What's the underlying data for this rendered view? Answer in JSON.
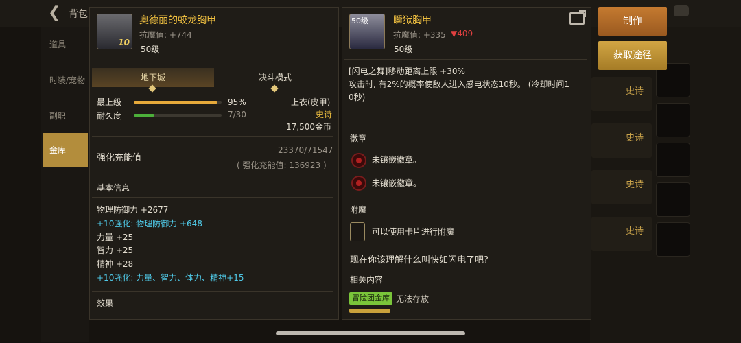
{
  "background": {
    "back_label": "背包",
    "sidebar": [
      "道具",
      "时装/宠物",
      "副职",
      "金库"
    ],
    "rows": [
      "史诗",
      "史诗",
      "史诗",
      "史诗",
      "史诗"
    ]
  },
  "item1": {
    "name": "奥德丽的蛟龙胸甲",
    "resist": "抗魔值: +744",
    "level": "50级",
    "icon_badge": "10",
    "tabs": [
      "地下城",
      "决斗模式"
    ],
    "top_grade_label": "最上级",
    "top_grade_value": "95%",
    "top_grade_fill": 0.95,
    "durability_label": "耐久度",
    "durability_value": "7/30",
    "durability_fill": 0.2333,
    "type": "上衣(皮甲)",
    "rarity": "史诗",
    "price": "17,500金币",
    "charge_label": "强化充能值",
    "charge_value": "23370/71547",
    "charge_sub": "( 强化充能值: 136923 )",
    "basic_title": "基本信息",
    "stats": [
      {
        "text": "物理防御力 +2677",
        "color": "#e2dccf"
      },
      {
        "text": "+10强化: 物理防御力 +648",
        "color": "#4fc8e6"
      },
      {
        "text": "力量 +25",
        "color": "#e2dccf"
      },
      {
        "text": "智力 +25",
        "color": "#e2dccf"
      },
      {
        "text": "精神 +28",
        "color": "#e2dccf"
      },
      {
        "text": "+10强化: 力量、智力、体力、精神+15",
        "color": "#4fc8e6"
      }
    ],
    "effect_title": "效果"
  },
  "item2": {
    "name": "瞬狱胸甲",
    "icon_badge": "50级",
    "resist": "抗魔值: +335",
    "resist_diff": "▼409",
    "level": "50级",
    "desc_lines": [
      "[闪电之舞]移动距离上限 +30%",
      "攻击时, 有2%的概率使敌人进入感电状态10秒。 (冷却时间1",
      "0秒)"
    ],
    "badge_title": "徽章",
    "badge_slots": [
      "未镶嵌徽章。",
      "未镶嵌徽章。"
    ],
    "enchant_title": "附魔",
    "enchant_text": "可以使用卡片进行附魔",
    "flavor": "现在你该理解什么叫快如闪电了吧?",
    "related_title": "相关内容",
    "related_tag": "冒险团金库",
    "related_text": "无法存放"
  },
  "buttons": {
    "make": "制作",
    "obtain": "获取途径"
  },
  "colors": {
    "gold": "#f0c040",
    "cyan": "#4fc8e6",
    "red": "#e04040",
    "green": "#7ac53a"
  }
}
